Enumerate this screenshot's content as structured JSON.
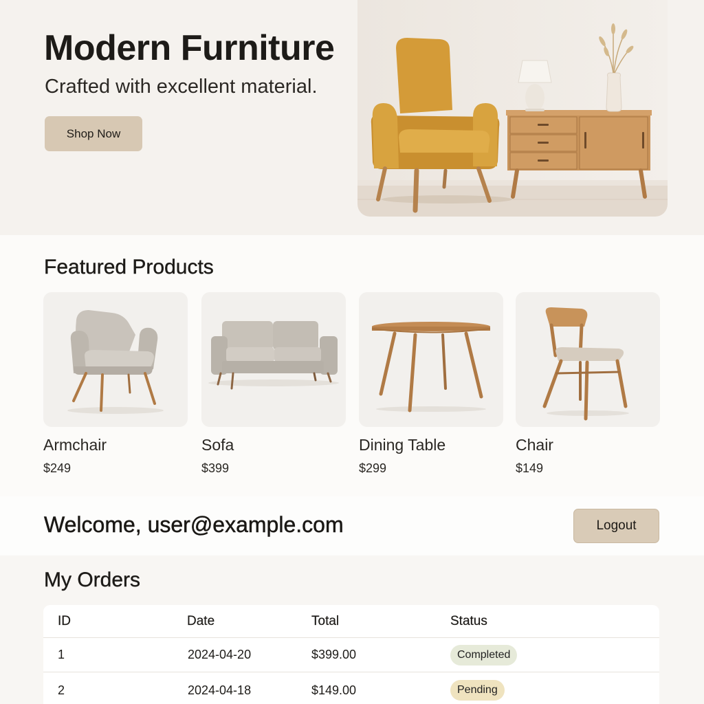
{
  "hero": {
    "title": "Modern Furniture",
    "subtitle": "Crafted with excellent material.",
    "shop_button": "Shop Now"
  },
  "featured": {
    "title": "Featured Products",
    "products": [
      {
        "name": "Armchair",
        "price": "$249",
        "image": "armchair-photo"
      },
      {
        "name": "Sofa",
        "price": "$399",
        "image": "sofa-photo"
      },
      {
        "name": "Dining Table",
        "price": "$299",
        "image": "dining-table-photo"
      },
      {
        "name": "Chair",
        "price": "$149",
        "image": "chair-photo"
      }
    ]
  },
  "account": {
    "welcome": "Welcome, user@example.com",
    "logout_button": "Logout"
  },
  "orders": {
    "title": "My Orders",
    "columns": [
      "ID",
      "Date",
      "Total",
      "Status"
    ],
    "rows": [
      {
        "id": "1",
        "date": "2024-04-20",
        "total": "$399.00",
        "status": "Completed"
      },
      {
        "id": "2",
        "date": "2024-04-18",
        "total": "$149.00",
        "status": "Pending"
      }
    ]
  },
  "colors": {
    "hero_background": "#f5f2ee",
    "button_tan": "#d7c8b3",
    "completed_badge": "#e6ead9",
    "pending_badge": "#efe3bf",
    "mustard": "#d2a03c",
    "wood": "#c8935a"
  }
}
